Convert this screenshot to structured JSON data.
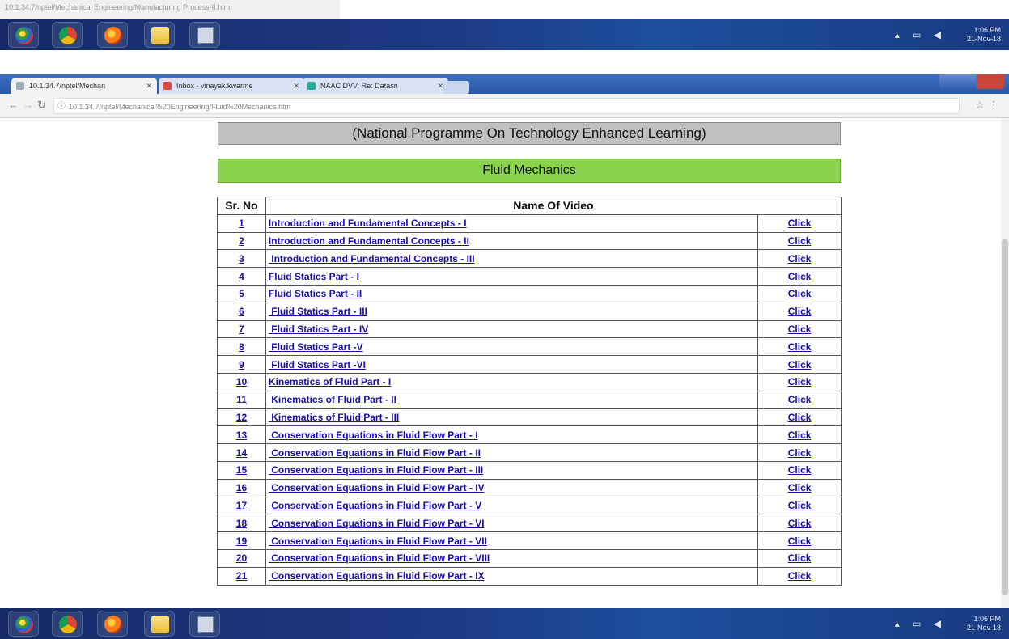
{
  "window_title": "10.1.34.7/nptel/Mechanical Engineering/Manufacturing Process-II.htm",
  "taskbar": {
    "time": "1:06 PM",
    "date": "21-Nov-18"
  },
  "browser": {
    "tabs": [
      {
        "label": "10.1.34.7/nptel/Mechan"
      },
      {
        "label": "Inbox - vinayak.kwarme"
      },
      {
        "label": "NAAC DVV: Re: Datasn"
      }
    ],
    "url": "10.1.34.7/nptel/Mechanical%20Engineering/Fluid%20Mechanics.htm"
  },
  "page": {
    "banner": "(National Programme On Technology Enhanced Learning)",
    "course_title": "Fluid Mechanics",
    "table": {
      "headers": [
        "Sr. No",
        "Name Of Video"
      ],
      "click_label": "Click",
      "rows": [
        {
          "num": "1",
          "name": "Introduction and Fundamental Concepts - I"
        },
        {
          "num": "2",
          "name": "Introduction and Fundamental Concepts - II"
        },
        {
          "num": "3",
          "name": " Introduction and Fundamental Concepts - III"
        },
        {
          "num": "4",
          "name": "Fluid Statics Part - I"
        },
        {
          "num": "5",
          "name": "Fluid Statics Part - II"
        },
        {
          "num": "6",
          "name": " Fluid Statics Part - III"
        },
        {
          "num": "7",
          "name": " Fluid Statics Part - IV"
        },
        {
          "num": "8",
          "name": " Fluid Statics Part -V"
        },
        {
          "num": "9",
          "name": " Fluid Statics Part -VI"
        },
        {
          "num": "10",
          "name": "Kinematics of Fluid Part - I"
        },
        {
          "num": "11",
          "name": " Kinematics of Fluid Part - II"
        },
        {
          "num": "12",
          "name": " Kinematics of Fluid Part - III"
        },
        {
          "num": "13",
          "name": " Conservation Equations in Fluid Flow Part - I"
        },
        {
          "num": "14",
          "name": " Conservation Equations in Fluid Flow Part - II"
        },
        {
          "num": "15",
          "name": " Conservation Equations in Fluid Flow Part - III"
        },
        {
          "num": "16",
          "name": " Conservation Equations in Fluid Flow Part - IV"
        },
        {
          "num": "17",
          "name": " Conservation Equations in Fluid Flow Part - V"
        },
        {
          "num": "18",
          "name": " Conservation Equations in Fluid Flow Part - VI"
        },
        {
          "num": "19",
          "name": " Conservation Equations in Fluid Flow Part - VII"
        },
        {
          "num": "20",
          "name": " Conservation Equations in Fluid Flow Part - VIII"
        },
        {
          "num": "21",
          "name": " Conservation Equations in Fluid Flow Part - IX"
        }
      ]
    }
  }
}
